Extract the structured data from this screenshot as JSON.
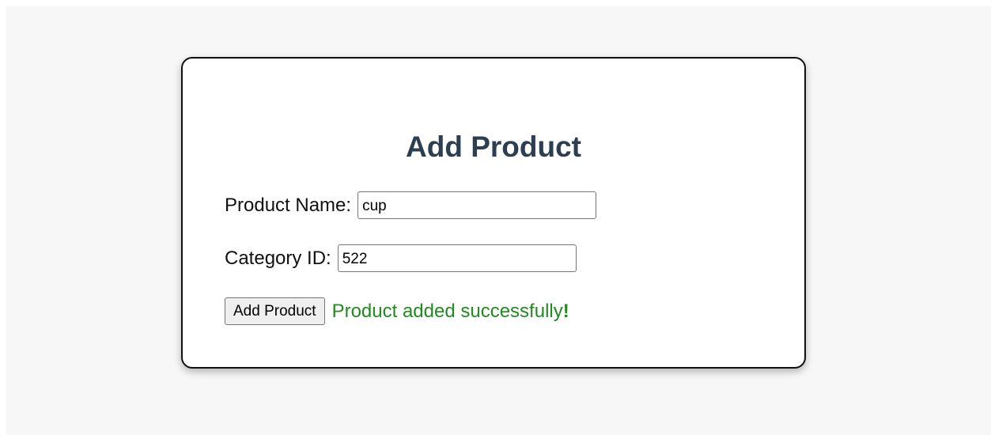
{
  "form": {
    "title": "Add Product",
    "product_name_label": "Product Name:",
    "product_name_value": "cup",
    "category_id_label": "Category ID:",
    "category_id_value": "522",
    "submit_label": "Add Product",
    "status_message": "Product added successfully",
    "status_suffix": "!"
  },
  "colors": {
    "page_background": "#f7f7f7",
    "card_background": "#ffffff",
    "card_border": "#111111",
    "title": "#2c3e50",
    "success": "#1e8c1e"
  }
}
